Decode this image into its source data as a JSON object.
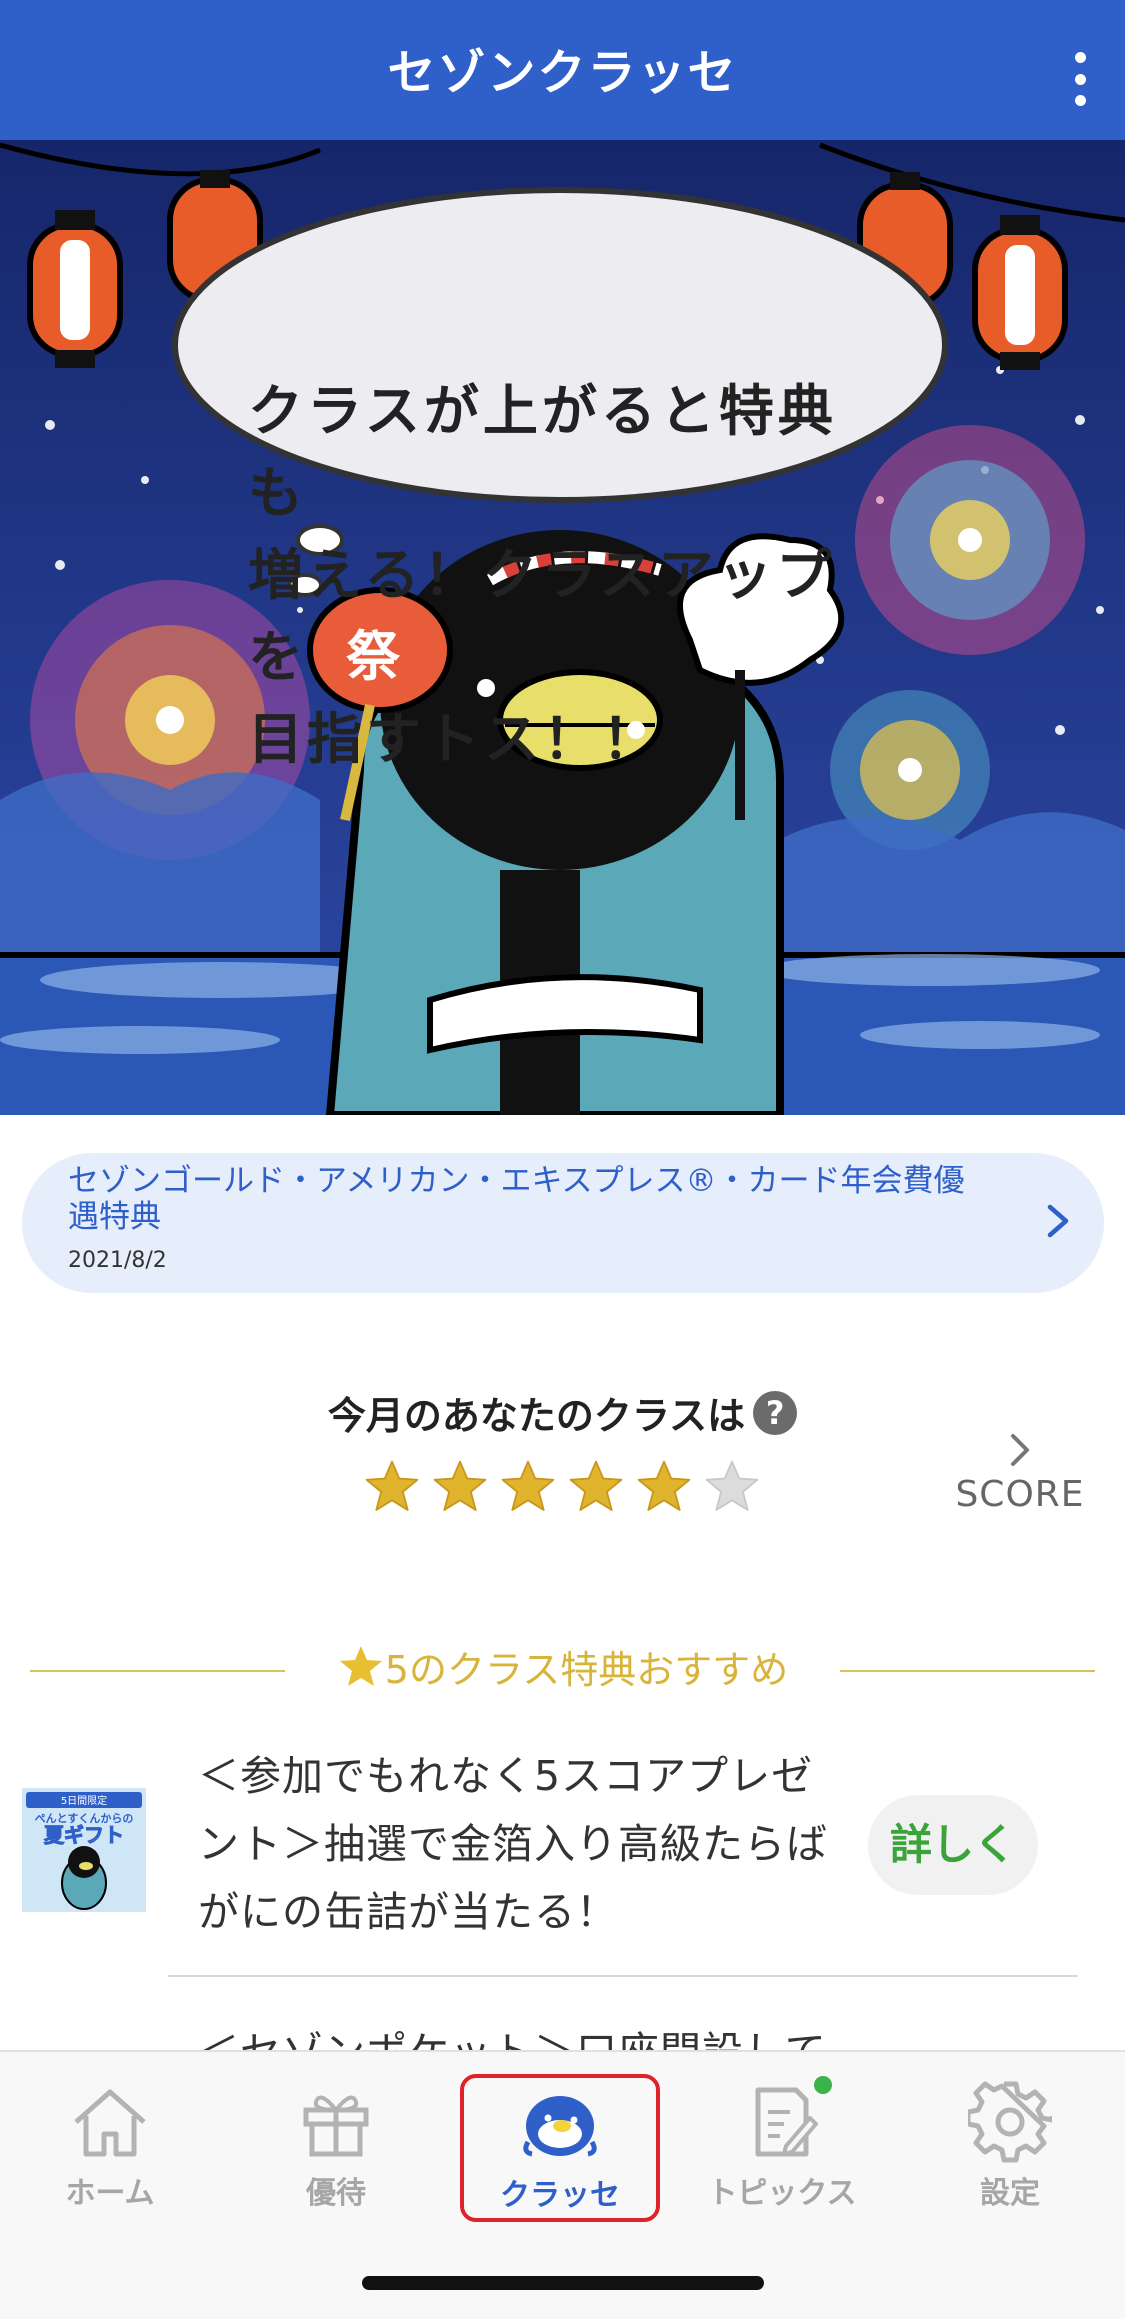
{
  "header": {
    "title": "セゾンクラッセ",
    "menu_icon": "more-vertical-icon",
    "bg_color": "#2f5fc9"
  },
  "banner": {
    "speech_lines": [
      "クラスが上がると特典も",
      "増える！クラスアップを",
      "目指すトス！！"
    ],
    "fan_text": "祭"
  },
  "news": {
    "title": "セゾンゴールド・アメリカン・エキスプレス®・カード年会費優遇特典",
    "date": "2021/8/2"
  },
  "class_status": {
    "label": "今月のあなたのクラスは",
    "help": "?",
    "stars_filled": 5,
    "stars_total": 6,
    "score_label": "SCORE"
  },
  "recommend": {
    "heading": "5のクラス特典おすすめ",
    "items": [
      {
        "text": "＜参加でもれなく5スコアプレゼント＞抽選で金箔入り高級たらばがにの缶詰が当たる！",
        "button": "詳しく",
        "thumb_small": "5日間限定",
        "thumb_title": "ぺんとすくんからの",
        "thumb_title2": "夏ギフト"
      }
    ],
    "next_partial": "＜セゾンポケット＞口座開設して"
  },
  "tabs": [
    {
      "label": "ホーム",
      "icon": "home-icon"
    },
    {
      "label": "優待",
      "icon": "gift-icon"
    },
    {
      "label": "クラッセ",
      "icon": "penguin-icon",
      "active": true
    },
    {
      "label": "トピックス",
      "icon": "topics-icon",
      "badge": true
    },
    {
      "label": "設定",
      "icon": "gear-icon"
    }
  ],
  "colors": {
    "accent": "#2f5fc9",
    "gold": "#d9b43a",
    "green": "#3aa33a",
    "active_outline": "#e0232b"
  }
}
